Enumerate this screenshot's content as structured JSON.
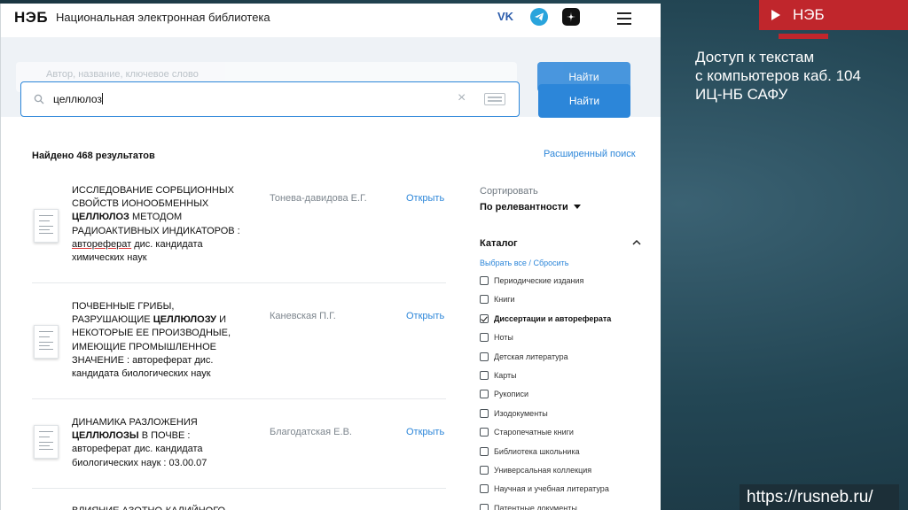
{
  "slide": {
    "tag": "НЭБ",
    "caption_lines": [
      "Доступ к текстам",
      "с компьютеров каб. 104",
      "ИЦ-НБ САФУ"
    ],
    "url": "https://rusneb.ru/"
  },
  "header": {
    "logo": "НЭБ",
    "site_name": "Национальная электронная библиотека",
    "social": [
      "vk-icon",
      "telegram-icon",
      "zen-icon"
    ],
    "vk_label": "VK"
  },
  "search": {
    "ghost_placeholder": "Автор, название, ключевое слово",
    "ghost_button": "Найти",
    "value": "целлюлоз",
    "clear": "×",
    "button": "Найти"
  },
  "results_header": {
    "found": "Найдено 468 результатов",
    "advanced": "Расширенный поиск"
  },
  "results": [
    {
      "title_parts": [
        {
          "t": "ИССЛЕДОВАНИЕ СОРБЦИОННЫХ СВОЙСТВ ИОНООБМЕННЫХ ",
          "s": "n"
        },
        {
          "t": "ЦЕЛЛЮЛОЗ",
          "s": "b"
        },
        {
          "t": " МЕТОДОМ РАДИОАКТИВНЫХ ИНДИКАТОРОВ : ",
          "s": "n"
        },
        {
          "t": "автореферат",
          "s": "u"
        },
        {
          "t": " дис. кандидата химических наук",
          "s": "n"
        }
      ],
      "author": "Тонева-давидова Е.Г.",
      "open": "Открыть"
    },
    {
      "title_parts": [
        {
          "t": "ПОЧВЕННЫЕ ГРИБЫ, РАЗРУШАЮЩИЕ ",
          "s": "n"
        },
        {
          "t": "ЦЕЛЛЮЛОЗУ",
          "s": "b"
        },
        {
          "t": " И НЕКОТОРЫЕ ЕЕ ПРОИЗВОДНЫЕ, ИМЕЮЩИЕ ПРОМЫШЛЕННОЕ ЗНАЧЕНИЕ : автореферат дис. кандидата биологических наук",
          "s": "n"
        }
      ],
      "author": "Каневская П.Г.",
      "open": "Открыть"
    },
    {
      "title_parts": [
        {
          "t": "ДИНАМИКА РАЗЛОЖЕНИЯ ",
          "s": "n"
        },
        {
          "t": "ЦЕЛЛЮЛОЗЫ",
          "s": "b"
        },
        {
          "t": " В ПОЧВЕ : автореферат дис. кандидата биологических наук : 03.00.07",
          "s": "n"
        }
      ],
      "author": "Благодатская Е.В.",
      "open": "Открыть"
    },
    {
      "title_parts": [
        {
          "t": "ВЛИЯНИЕ АЗОТНО-КАЛИЙНОГО",
          "s": "n"
        }
      ],
      "author": "",
      "open": ""
    }
  ],
  "filters": {
    "sort_label": "Сортировать",
    "sort_value": "По релевантности",
    "catalog_title": "Каталог",
    "catalog_actions": "Выбрать все / Сбросить",
    "catalog_items": [
      {
        "label": "Периодические издания",
        "checked": false
      },
      {
        "label": "Книги",
        "checked": false
      },
      {
        "label": "Диссертации и автореферата",
        "checked": true
      },
      {
        "label": "Ноты",
        "checked": false
      },
      {
        "label": "Детская литература",
        "checked": false
      },
      {
        "label": "Карты",
        "checked": false
      },
      {
        "label": "Рукописи",
        "checked": false
      },
      {
        "label": "Изодокументы",
        "checked": false
      },
      {
        "label": "Старопечатные книги",
        "checked": false
      },
      {
        "label": "Библиотека школьника",
        "checked": false
      },
      {
        "label": "Универсальная коллекция",
        "checked": false
      },
      {
        "label": "Научная и учебная литература",
        "checked": false
      },
      {
        "label": "Патентные документы",
        "checked": false
      }
    ]
  }
}
